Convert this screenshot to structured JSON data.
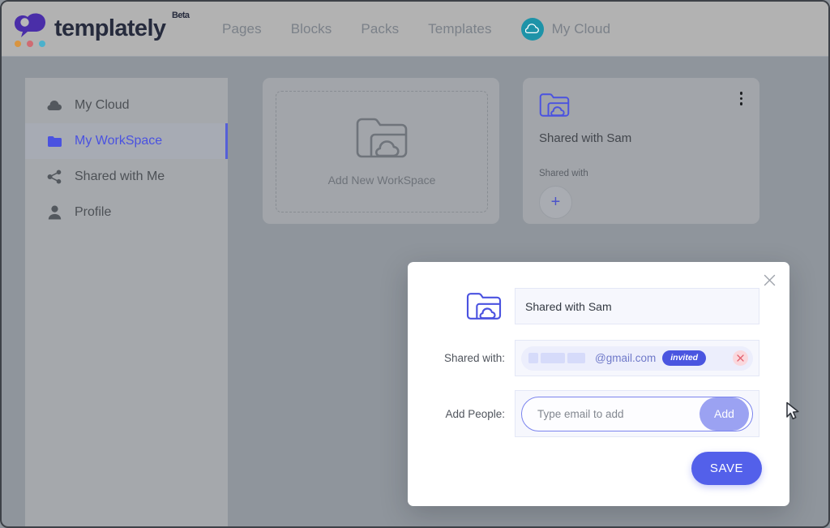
{
  "header": {
    "brand": "templately",
    "brand_badge": "Beta",
    "nav": [
      {
        "label": "Pages",
        "icon": ""
      },
      {
        "label": "Blocks",
        "icon": ""
      },
      {
        "label": "Packs",
        "icon": ""
      },
      {
        "label": "Templates",
        "icon": ""
      },
      {
        "label": "My Cloud",
        "icon": "cloud-icon"
      }
    ]
  },
  "sidebar": {
    "items": [
      {
        "label": "My Cloud",
        "icon": "cloud-icon",
        "active": false
      },
      {
        "label": "My WorkSpace",
        "icon": "folder-icon",
        "active": true
      },
      {
        "label": "Shared with Me",
        "icon": "share-icon",
        "active": false
      },
      {
        "label": "Profile",
        "icon": "person-icon",
        "active": false
      }
    ]
  },
  "content": {
    "add_workspace": {
      "label": "Add New WorkSpace",
      "icon": "folder-cloud-icon"
    },
    "workspace_card": {
      "icon": "folder-cloud-icon",
      "title": "Shared with Sam",
      "shared_with_label": "Shared with",
      "add_person_symbol": "+",
      "menu_icon": "kebab-menu-icon"
    }
  },
  "modal": {
    "close_icon": "close-icon",
    "folder_icon": "folder-cloud-icon",
    "workspace_name": "Shared with Sam",
    "shared_with_label": "Shared with:",
    "shared_entry": {
      "email_domain": "@gmail.com",
      "status_badge": "invited",
      "remove_icon": "remove-icon"
    },
    "add_people_label": "Add People:",
    "add_people_placeholder": "Type email to add",
    "add_people_value": "",
    "add_button": "Add",
    "save_button": "SAVE",
    "cursor_icon": "mouse-cursor-icon"
  },
  "colors": {
    "accent_indigo": "#5360ea",
    "accent_light_indigo": "#9ba2f2",
    "cloud_teal": "#1e93a8",
    "brand_purple": "#4a2ea8",
    "remove_red": "#e2606e",
    "page_bg": "#8f959c",
    "header_bg": "#b2b2b2",
    "sidebar_bg": "#a5a8ac"
  }
}
